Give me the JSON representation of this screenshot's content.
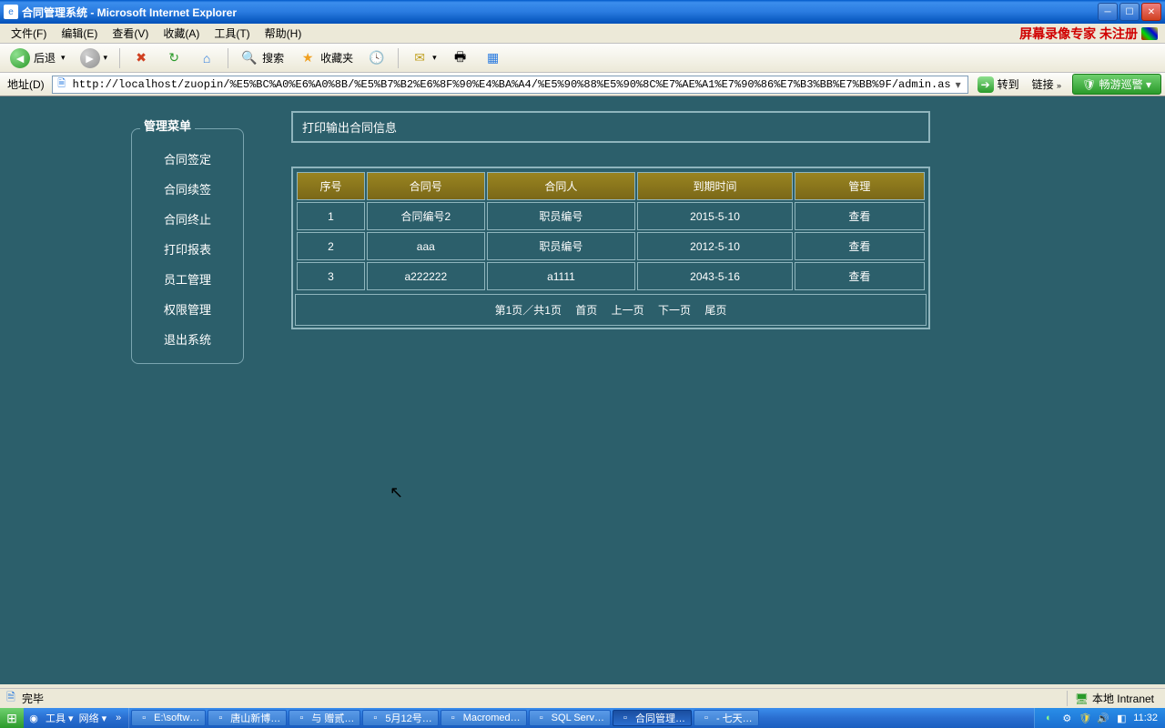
{
  "window": {
    "title": "合同管理系统 - Microsoft Internet Explorer"
  },
  "menubar": {
    "items": [
      "文件(F)",
      "编辑(E)",
      "查看(V)",
      "收藏(A)",
      "工具(T)",
      "帮助(H)"
    ],
    "watermark": "屏幕录像专家 未注册"
  },
  "toolbar": {
    "back": "后退",
    "search": "搜索",
    "favorites": "收藏夹"
  },
  "addressbar": {
    "label": "地址(D)",
    "url": "http://localhost/zuopin/%E5%BC%A0%E6%A0%8B/%E5%B7%B2%E6%8F%90%E4%BA%A4/%E5%90%88%E5%90%8C%E7%AE%A1%E7%90%86%E7%B3%BB%E7%BB%9F/admin.asp",
    "go": "转到",
    "links": "链接",
    "ext": "畅游巡警"
  },
  "sidebar": {
    "title": "管理菜单",
    "items": [
      "合同签定",
      "合同续签",
      "合同终止",
      "打印报表",
      "员工管理",
      "权限管理",
      "退出系统"
    ]
  },
  "panel": {
    "header": "打印输出合同信息",
    "columns": [
      "序号",
      "合同号",
      "合同人",
      "到期时间",
      "管理"
    ],
    "rows": [
      {
        "seq": "1",
        "no": "合同编号2",
        "person": "职员编号",
        "expire": "2015-5-10",
        "action": "查看"
      },
      {
        "seq": "2",
        "no": "aaa",
        "person": "职员编号",
        "expire": "2012-5-10",
        "action": "查看"
      },
      {
        "seq": "3",
        "no": "a222222",
        "person": "a1111",
        "expire": "2043-5-16",
        "action": "查看"
      }
    ],
    "pager": {
      "info": "第1页／共1页",
      "first": "首页",
      "prev": "上一页",
      "next": "下一页",
      "last": "尾页"
    }
  },
  "statusbar": {
    "status": "完毕",
    "zone": "本地 Intranet"
  },
  "taskbar": {
    "ql": {
      "tools": "工具",
      "network": "网络"
    },
    "tasks": [
      {
        "label": "E:\\softw…"
      },
      {
        "label": "唐山新博…"
      },
      {
        "label": "与 赠贰…"
      },
      {
        "label": "5月12号…"
      },
      {
        "label": "Macromed…"
      },
      {
        "label": "SQL Serv…"
      },
      {
        "label": "合同管理…",
        "active": true
      },
      {
        "label": "- 七天…"
      }
    ],
    "clock": "11:32"
  }
}
